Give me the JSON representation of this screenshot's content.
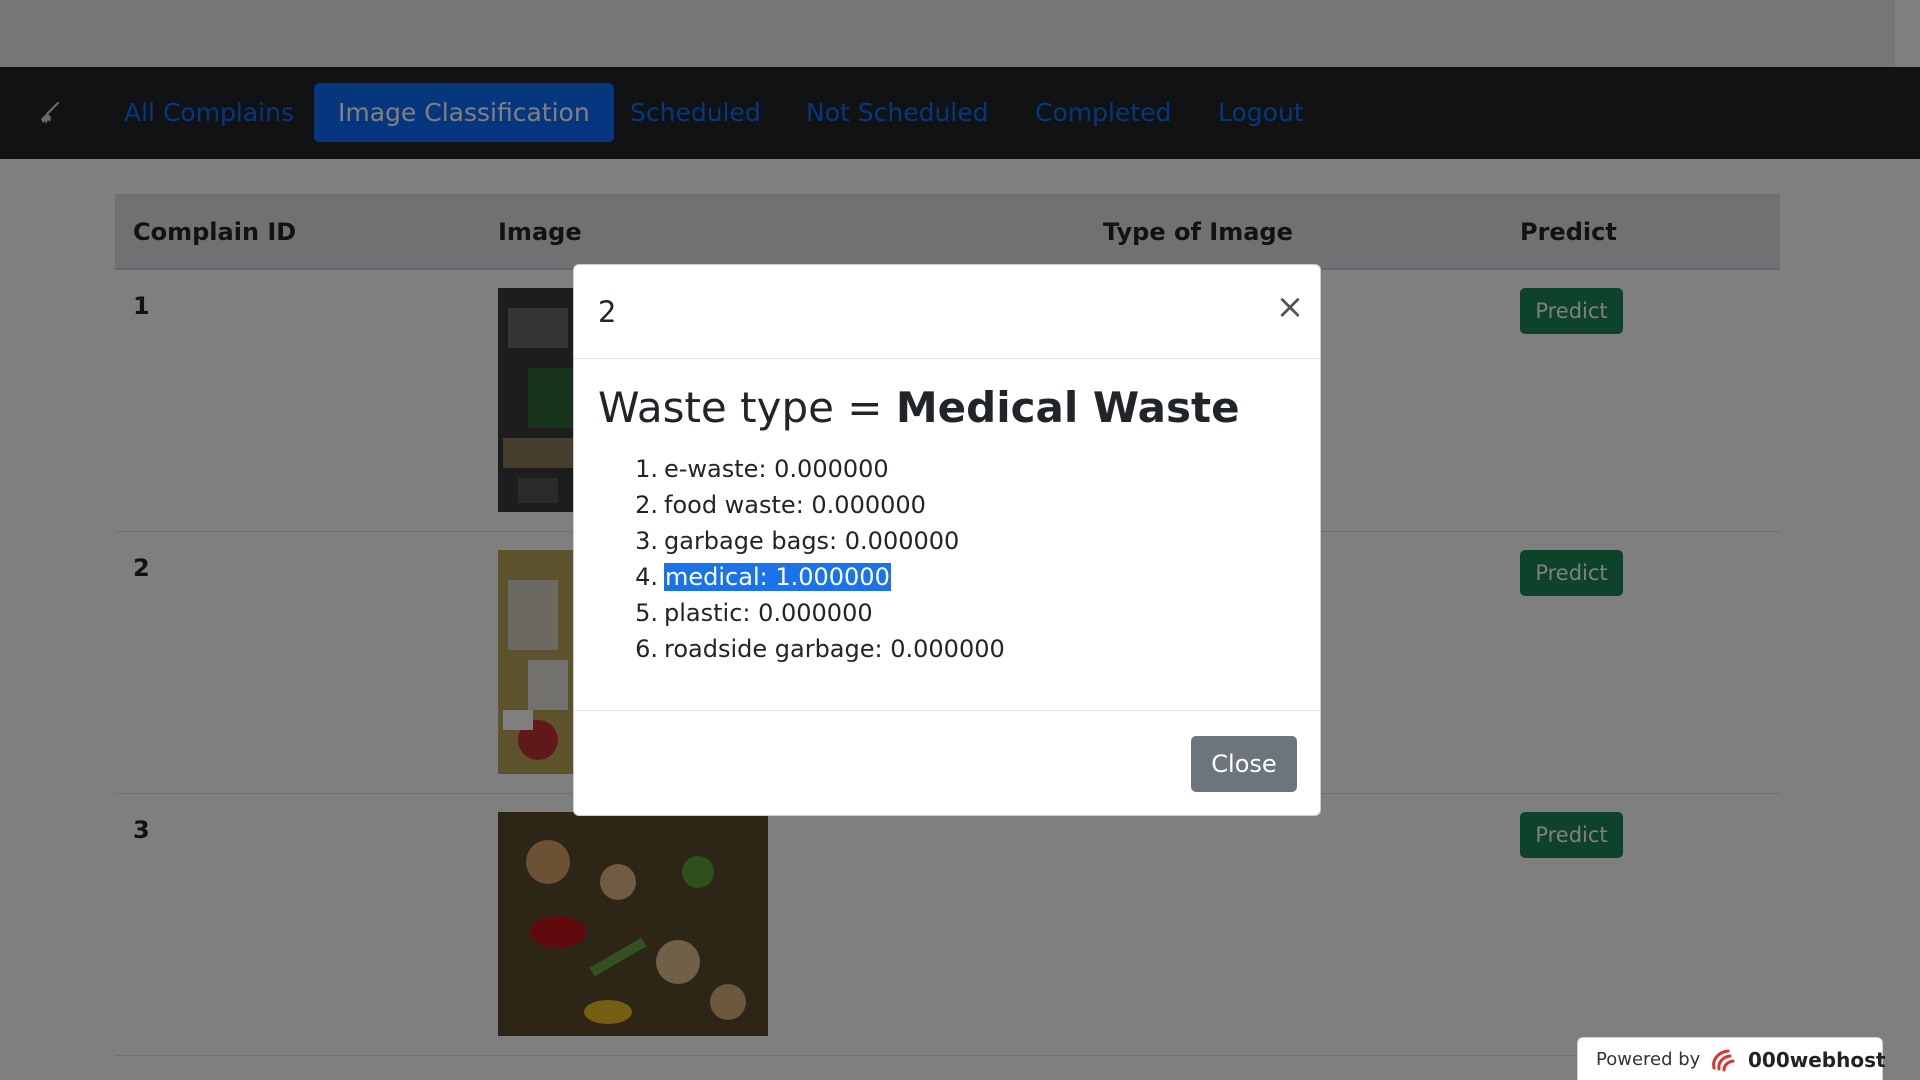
{
  "nav": {
    "brand_icon": "broom-icon",
    "items": [
      {
        "label": "All Complains",
        "active": false
      },
      {
        "label": "Image Classification",
        "active": true
      },
      {
        "label": "Scheduled",
        "active": false
      },
      {
        "label": "Not Scheduled",
        "active": false
      },
      {
        "label": "Completed",
        "active": false
      },
      {
        "label": "Logout",
        "active": false
      }
    ]
  },
  "table": {
    "headers": [
      "Complain ID",
      "Image",
      "Type of Image",
      "Predict"
    ],
    "rows": [
      {
        "id": "1",
        "image": "e-waste photo",
        "predict_label": "Predict"
      },
      {
        "id": "2",
        "image": "medical waste photo",
        "predict_label": "Predict"
      },
      {
        "id": "3",
        "image": "food waste photo",
        "predict_label": "Predict"
      }
    ]
  },
  "modal": {
    "title": "2",
    "heading_prefix": "Waste type = ",
    "heading_value": "Medical Waste",
    "scores": [
      {
        "num": "1.",
        "text": "e-waste: 0.000000"
      },
      {
        "num": "2.",
        "text": "food waste: 0.000000"
      },
      {
        "num": "3.",
        "text": "garbage bags: 0.000000"
      },
      {
        "num": "4.",
        "text": "medical: 1.000000",
        "selected": true
      },
      {
        "num": "5.",
        "text": "plastic: 0.000000"
      },
      {
        "num": "6.",
        "text": "roadside garbage: 0.000000"
      }
    ],
    "close_label": "Close"
  },
  "footer_badge": {
    "label": "Powered by",
    "brand": "000webhost"
  },
  "colors": {
    "navbar": "#212529",
    "link": "#0d6efd",
    "predict": "#198754",
    "close": "#6c757d",
    "selection": "#1a73e8"
  }
}
